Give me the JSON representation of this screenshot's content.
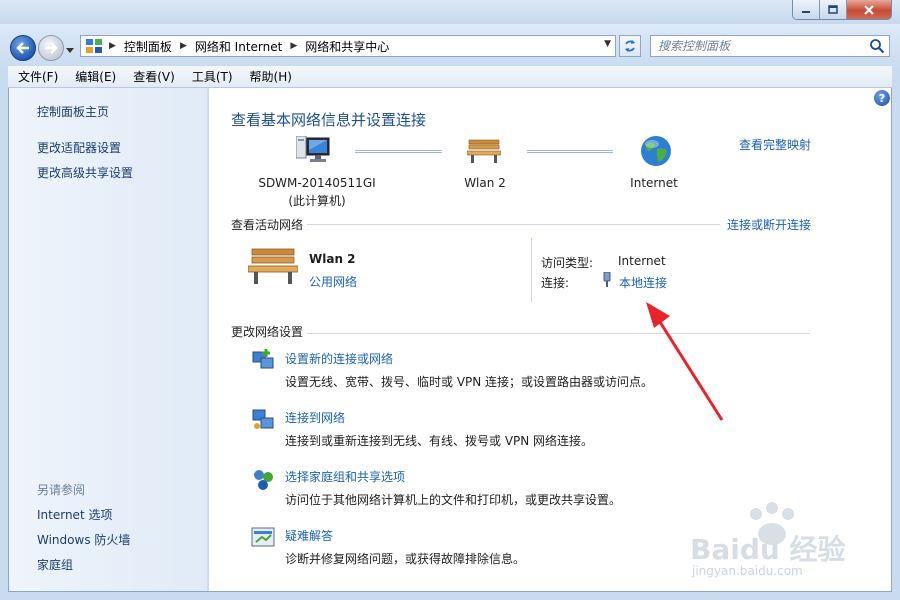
{
  "window": {
    "caption_buttons": [
      "minimize-icon",
      "maximize-icon",
      "close-icon"
    ]
  },
  "address": {
    "crumbs": [
      "控制面板",
      "网络和 Internet",
      "网络和共享中心"
    ],
    "search_placeholder": "搜索控制面板"
  },
  "menu": [
    "文件(F)",
    "编辑(E)",
    "查看(V)",
    "工具(T)",
    "帮助(H)"
  ],
  "sidebar": {
    "home": "控制面板主页",
    "tasks": [
      "更改适配器设置",
      "更改高级共享设置"
    ],
    "see_also_title": "另请参阅",
    "see_also": [
      "Internet 选项",
      "Windows 防火墙",
      "家庭组"
    ]
  },
  "main": {
    "title": "查看基本网络信息并设置连接",
    "view_full_map": "查看完整映射",
    "map": {
      "computer_name": "SDWM-20140511GI",
      "computer_sub": "(此计算机)",
      "network_name": "Wlan  2",
      "internet": "Internet"
    },
    "active": {
      "heading": "查看活动网络",
      "connect_disconnect": "连接或断开连接",
      "network_name": "Wlan  2",
      "network_type": "公用网络",
      "access_type_label": "访问类型:",
      "access_type_value": "Internet",
      "connection_label": "连接:",
      "connection_value": "本地连接"
    },
    "change": {
      "heading": "更改网络设置",
      "items": [
        {
          "title": "设置新的连接或网络",
          "desc": "设置无线、宽带、拨号、临时或 VPN 连接；或设置路由器或访问点。",
          "icon": "new-connection-icon"
        },
        {
          "title": "连接到网络",
          "desc": "连接到或重新连接到无线、有线、拨号或 VPN 网络连接。",
          "icon": "connect-network-icon"
        },
        {
          "title": "选择家庭组和共享选项",
          "desc": "访问位于其他网络计算机上的文件和打印机，或更改共享设置。",
          "icon": "homegroup-icon"
        },
        {
          "title": "疑难解答",
          "desc": "诊断并修复网络问题，或获得故障排除信息。",
          "icon": "troubleshoot-icon"
        }
      ]
    }
  },
  "watermark": {
    "logo": "Baidu 经验",
    "url": "jingyan.baidu.com"
  },
  "colors": {
    "link": "#1b62b3",
    "title": "#1e4f92",
    "annotation_arrow": "#e8232a"
  }
}
